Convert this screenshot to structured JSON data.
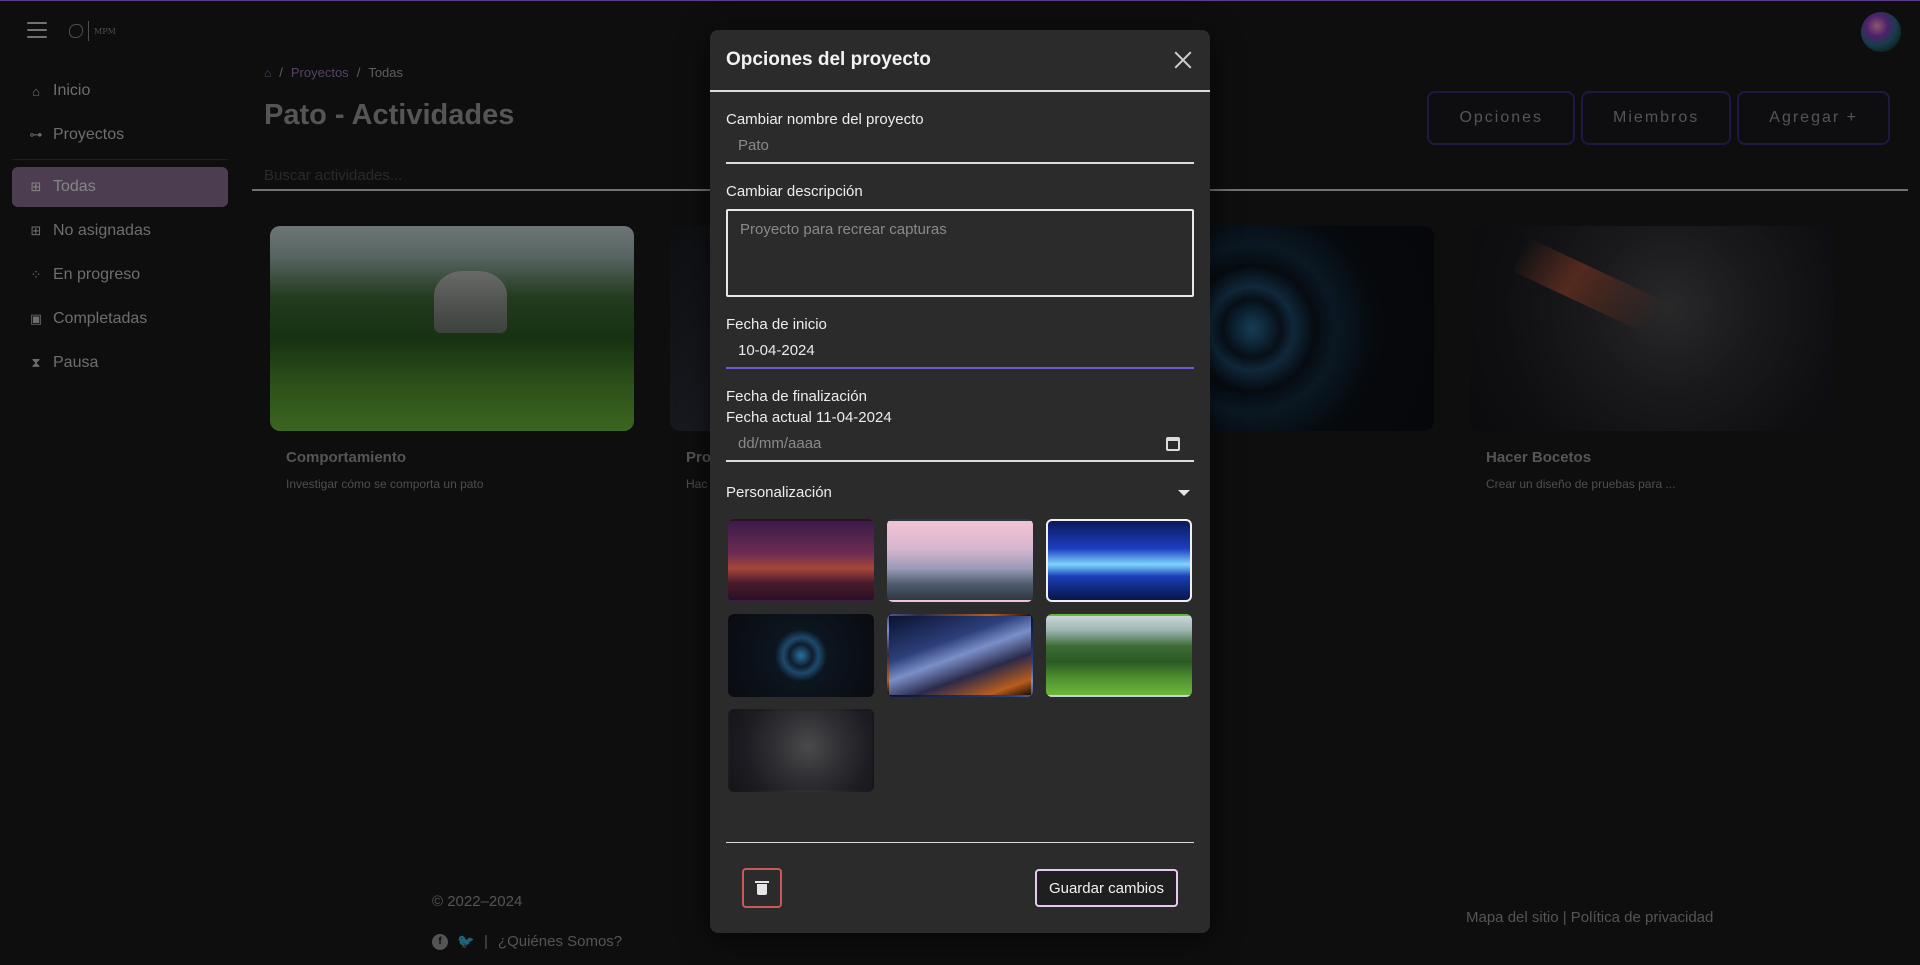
{
  "app": {
    "logo_text": "MPM"
  },
  "sidebar": {
    "items": [
      {
        "label": "Inicio",
        "icon": "home-icon"
      },
      {
        "label": "Proyectos",
        "icon": "sitemap-icon"
      },
      {
        "label": "Todas",
        "icon": "grid-icon",
        "active": true
      },
      {
        "label": "No asignadas",
        "icon": "grid-outline-icon"
      },
      {
        "label": "En progreso",
        "icon": "spinner-icon"
      },
      {
        "label": "Completadas",
        "icon": "calendar-check-icon"
      },
      {
        "label": "Pausa",
        "icon": "hourglass-icon"
      }
    ]
  },
  "breadcrumb": {
    "items": [
      "Proyectos",
      "Todas"
    ],
    "separator": "/"
  },
  "header": {
    "title": "Pato - Actividades",
    "actions": [
      "Opciones",
      "Miembros",
      "Agregar +"
    ]
  },
  "search": {
    "placeholder": "Buscar actividades..."
  },
  "cards": [
    {
      "title": "Comportamiento",
      "description": "Investigar cómo se comporta un pato"
    },
    {
      "title": "Pro",
      "description": "Hac"
    },
    {
      "title": "",
      "description": ""
    },
    {
      "title": "Hacer Bocetos",
      "description": "Crear un diseño de pruebas para ..."
    }
  ],
  "footer": {
    "copyright": "© 2022–2024",
    "separator": "|",
    "about": "¿Quiénes Somos?",
    "links": "Mapa del sitio | Política de privacidad"
  },
  "modal": {
    "title": "Opciones del proyecto",
    "rename_label": "Cambiar nombre del proyecto",
    "rename_placeholder": "Pato",
    "description_label": "Cambiar descripción",
    "description_placeholder": "Proyecto para recrear capturas",
    "start_label": "Fecha de inicio",
    "start_value": "10-04-2024",
    "end_label": "Fecha de finalización",
    "end_current": "Fecha actual 11-04-2024",
    "end_placeholder": "dd/mm/aaaa",
    "personalization_label": "Personalización",
    "backgrounds_count": 7,
    "selected_background_index": 2,
    "save_label": "Guardar cambios"
  },
  "colors": {
    "accent_purple": "#8c6f93",
    "button_border": "#3a2e77",
    "date_underline": "#6a5cd6",
    "delete_border": "#c55a5a"
  }
}
